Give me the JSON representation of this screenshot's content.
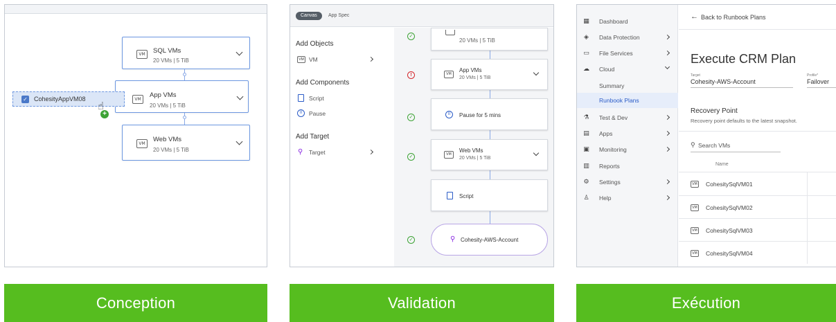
{
  "panel1": {
    "nodes": [
      {
        "title": "SQL VMs",
        "sub": "20 VMs  |  5 TiB",
        "icon": "VM"
      },
      {
        "title": "App VMs",
        "sub": "20 VMs  |  5 TiB",
        "icon": "VM"
      },
      {
        "title": "Web VMs",
        "sub": "20 VMs  |  5 TiB",
        "icon": "VM"
      }
    ],
    "drag_item": "CohesityAppVM08",
    "add_badge": "+"
  },
  "panel2": {
    "tabs": [
      "Canvas",
      "App Spec"
    ],
    "sidebar": {
      "add_objects": "Add Objects",
      "vm": "VM",
      "add_components": "Add Components",
      "script": "Script",
      "pause": "Pause",
      "add_target": "Add Target",
      "target": "Target"
    },
    "cards": [
      {
        "title": "",
        "sub": "20 VMs  |  5 TiB"
      },
      {
        "title": "App VMs",
        "sub": "20 VMs  |  5 TiB"
      },
      {
        "title": "Pause for 5 mins",
        "sub": ""
      },
      {
        "title": "Web VMs",
        "sub": "20 VMs  |  5 TiB"
      },
      {
        "title": "Script",
        "sub": ""
      },
      {
        "title": "Cohesity-AWS-Account",
        "sub": ""
      }
    ],
    "status_ok": "✓",
    "status_err": "!"
  },
  "panel3": {
    "nav": [
      {
        "label": "Dashboard",
        "icon": "▦"
      },
      {
        "label": "Data Protection",
        "icon": "◈"
      },
      {
        "label": "File Services",
        "icon": "▭"
      },
      {
        "label": "Cloud",
        "icon": "☁"
      },
      {
        "label": "Summary",
        "icon": ""
      },
      {
        "label": "Runbook Plans",
        "icon": ""
      },
      {
        "label": "Test & Dev",
        "icon": "⚗"
      },
      {
        "label": "Apps",
        "icon": "▤"
      },
      {
        "label": "Monitoring",
        "icon": "▣"
      },
      {
        "label": "Reports",
        "icon": "▥"
      },
      {
        "label": "Settings",
        "icon": "⚙"
      },
      {
        "label": "Help",
        "icon": "♙"
      }
    ],
    "back_link": "Back to Runbook Plans",
    "plan_title": "Execute CRM Plan",
    "target_label": "Target",
    "target_value": "Cohesity-AWS-Account",
    "profile_label": "Profile*",
    "profile_value": "Failover",
    "recovery_title": "Recovery Point",
    "recovery_desc": "Recovery point defaults to the latest snapshot.",
    "search_placeholder": "Search VMs",
    "col_name": "Name",
    "rows": [
      "CohesitySqlVM01",
      "CohesitySqlVM02",
      "CohesitySqlVM03",
      "CohesitySqlVM04"
    ]
  },
  "banners": [
    "Conception",
    "Validation",
    "Exécution"
  ],
  "colors": {
    "banner": "#56bd1f",
    "accent": "#2a5bc7",
    "ok": "#3da335",
    "error": "#d4272c"
  }
}
